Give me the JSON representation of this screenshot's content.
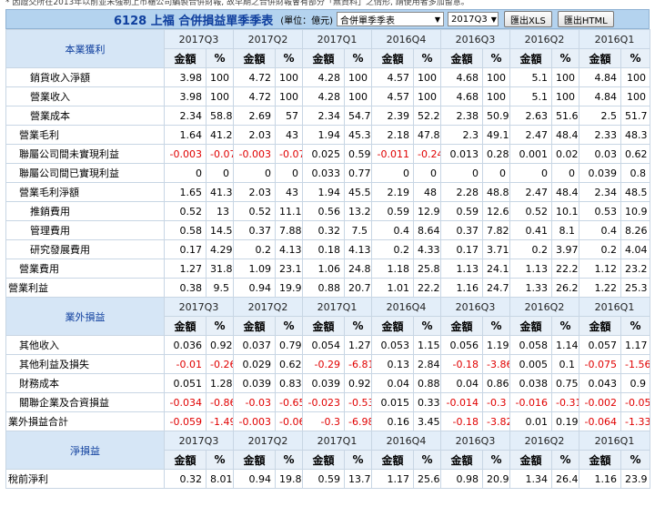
{
  "notice": "* 因證交所在2013年以前並未強制上市櫃公司編製合併財報, 故早期之合併財報會有部分「無資料」之情形, 請使用者多加留意。",
  "header": {
    "title": "6128 上福 合併損益單季季表",
    "unit": "(單位：億元)",
    "report_select": "合併單季季表",
    "period_select": "2017Q3",
    "export_xls": "匯出XLS",
    "export_html": "匯出HTML"
  },
  "table": {
    "sub_headers": [
      "金額",
      "%"
    ],
    "sections": [
      {
        "title": "本業獲利",
        "periods": [
          "2017Q3",
          "2017Q2",
          "2017Q1",
          "2016Q4",
          "2016Q3",
          "2016Q2",
          "2016Q1"
        ],
        "rows": [
          {
            "label": "銷貨收入淨額",
            "indent": "i3",
            "values": [
              "3.98",
              "100",
              "4.72",
              "100",
              "4.28",
              "100",
              "4.57",
              "100",
              "4.68",
              "100",
              "5.1",
              "100",
              "4.84",
              "100"
            ]
          },
          {
            "label": "營業收入",
            "indent": "i2",
            "values": [
              "3.98",
              "100",
              "4.72",
              "100",
              "4.28",
              "100",
              "4.57",
              "100",
              "4.68",
              "100",
              "5.1",
              "100",
              "4.84",
              "100"
            ]
          },
          {
            "label": "營業成本",
            "indent": "i2",
            "values": [
              "2.34",
              "58.8",
              "2.69",
              "57",
              "2.34",
              "54.7",
              "2.39",
              "52.2",
              "2.38",
              "50.9",
              "2.63",
              "51.6",
              "2.5",
              "51.7"
            ]
          },
          {
            "label": "營業毛利",
            "indent": "i1",
            "values": [
              "1.64",
              "41.2",
              "2.03",
              "43",
              "1.94",
              "45.3",
              "2.18",
              "47.8",
              "2.3",
              "49.1",
              "2.47",
              "48.4",
              "2.33",
              "48.3"
            ]
          },
          {
            "label": "聯屬公司間未實現利益",
            "indent": "i1",
            "values": [
              "-0.003",
              "-0.07",
              "-0.003",
              "-0.07",
              "0.025",
              "0.59",
              "-0.011",
              "-0.24",
              "0.013",
              "0.28",
              "0.001",
              "0.02",
              "0.03",
              "0.62"
            ]
          },
          {
            "label": "聯屬公司間已實現利益",
            "indent": "i1",
            "values": [
              "0",
              "0",
              "0",
              "0",
              "0.033",
              "0.77",
              "0",
              "0",
              "0",
              "0",
              "0",
              "0",
              "0.039",
              "0.8"
            ]
          },
          {
            "label": "營業毛利淨額",
            "indent": "i1",
            "values": [
              "1.65",
              "41.3",
              "2.03",
              "43",
              "1.94",
              "45.5",
              "2.19",
              "48",
              "2.28",
              "48.8",
              "2.47",
              "48.4",
              "2.34",
              "48.5"
            ]
          },
          {
            "label": "推銷費用",
            "indent": "i2",
            "values": [
              "0.52",
              "13",
              "0.52",
              "11.1",
              "0.56",
              "13.2",
              "0.59",
              "12.9",
              "0.59",
              "12.6",
              "0.52",
              "10.1",
              "0.53",
              "10.9"
            ]
          },
          {
            "label": "管理費用",
            "indent": "i2",
            "values": [
              "0.58",
              "14.5",
              "0.37",
              "7.88",
              "0.32",
              "7.5",
              "0.4",
              "8.64",
              "0.37",
              "7.82",
              "0.41",
              "8.1",
              "0.4",
              "8.26"
            ]
          },
          {
            "label": "研究發展費用",
            "indent": "i2",
            "values": [
              "0.17",
              "4.29",
              "0.2",
              "4.13",
              "0.18",
              "4.13",
              "0.2",
              "4.33",
              "0.17",
              "3.71",
              "0.2",
              "3.97",
              "0.2",
              "4.04"
            ]
          },
          {
            "label": "營業費用",
            "indent": "i1",
            "values": [
              "1.27",
              "31.8",
              "1.09",
              "23.1",
              "1.06",
              "24.8",
              "1.18",
              "25.8",
              "1.13",
              "24.1",
              "1.13",
              "22.2",
              "1.12",
              "23.2"
            ]
          },
          {
            "label": "營業利益",
            "indent": "i0",
            "values": [
              "0.38",
              "9.5",
              "0.94",
              "19.9",
              "0.88",
              "20.7",
              "1.01",
              "22.2",
              "1.16",
              "24.7",
              "1.33",
              "26.2",
              "1.22",
              "25.3"
            ]
          }
        ]
      },
      {
        "title": "業外損益",
        "periods": [
          "2017Q3",
          "2017Q2",
          "2017Q1",
          "2016Q4",
          "2016Q3",
          "2016Q2",
          "2016Q1"
        ],
        "rows": [
          {
            "label": "其他收入",
            "indent": "i1",
            "values": [
              "0.036",
              "0.92",
              "0.037",
              "0.79",
              "0.054",
              "1.27",
              "0.053",
              "1.15",
              "0.056",
              "1.19",
              "0.058",
              "1.14",
              "0.057",
              "1.17"
            ]
          },
          {
            "label": "其他利益及損失",
            "indent": "i1",
            "values": [
              "-0.01",
              "-0.26",
              "0.029",
              "0.62",
              "-0.29",
              "-6.81",
              "0.13",
              "2.84",
              "-0.18",
              "-3.86",
              "0.005",
              "0.1",
              "-0.075",
              "-1.56"
            ]
          },
          {
            "label": "財務成本",
            "indent": "i1",
            "values": [
              "0.051",
              "1.28",
              "0.039",
              "0.83",
              "0.039",
              "0.92",
              "0.04",
              "0.88",
              "0.04",
              "0.86",
              "0.038",
              "0.75",
              "0.043",
              "0.9"
            ]
          },
          {
            "label": "關聯企業及合資損益",
            "indent": "i1",
            "values": [
              "-0.034",
              "-0.86",
              "-0.03",
              "-0.65",
              "-0.023",
              "-0.53",
              "0.015",
              "0.33",
              "-0.014",
              "-0.3",
              "-0.016",
              "-0.31",
              "-0.002",
              "-0.05"
            ]
          },
          {
            "label": "業外損益合計",
            "indent": "i0",
            "values": [
              "-0.059",
              "-1.49",
              "-0.003",
              "-0.06",
              "-0.3",
              "-6.98",
              "0.16",
              "3.45",
              "-0.18",
              "-3.82",
              "0.01",
              "0.19",
              "-0.064",
              "-1.33"
            ]
          }
        ]
      },
      {
        "title": "淨損益",
        "periods": [
          "2017Q3",
          "2017Q2",
          "2017Q1",
          "2016Q4",
          "2016Q3",
          "2016Q2",
          "2016Q1"
        ],
        "rows": [
          {
            "label": "稅前淨利",
            "indent": "i0",
            "values": [
              "0.32",
              "8.01",
              "0.94",
              "19.8",
              "0.59",
              "13.7",
              "1.17",
              "25.6",
              "0.98",
              "20.9",
              "1.34",
              "26.4",
              "1.16",
              "23.9"
            ]
          }
        ]
      }
    ]
  },
  "colors": {
    "negative": "#e00000",
    "section_title": "#0f3f9e",
    "header_bg": "#b4d3ef"
  }
}
